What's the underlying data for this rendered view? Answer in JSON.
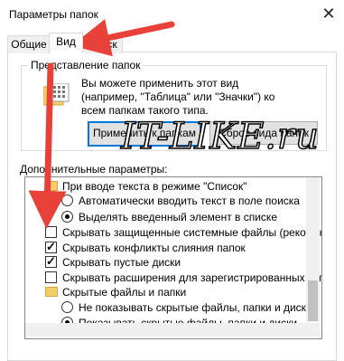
{
  "window": {
    "title": "Параметры папок",
    "close_glyph": "✕"
  },
  "tabs": [
    {
      "label": "Общие",
      "active": false
    },
    {
      "label": "Вид",
      "active": true
    },
    {
      "label": "Поиск",
      "active": false
    }
  ],
  "folder_view": {
    "group_label": "Представление папок",
    "description": "Вы можете применить этот вид (например, \"Таблица\" или \"Значки\") ко всем папкам такого типа.",
    "apply_button": "Применить к папкам",
    "reset_button": "Сброс вида папок"
  },
  "advanced": {
    "label": "Дополнительные параметры:",
    "items": [
      {
        "type": "folder",
        "text": "При вводе текста в режиме \"Список\"",
        "indent": 0
      },
      {
        "type": "radio",
        "text": "Автоматически вводить текст в поле поиска",
        "checked": false,
        "indent": 1
      },
      {
        "type": "radio",
        "text": "Выделять введенный элемент в списке",
        "checked": true,
        "indent": 1
      },
      {
        "type": "checkbox",
        "text": "Скрывать защищенные системные файлы (рекомен...",
        "checked": false,
        "indent": 0
      },
      {
        "type": "checkbox",
        "text": "Скрывать конфликты слияния папок",
        "checked": true,
        "indent": 0
      },
      {
        "type": "checkbox",
        "text": "Скрывать пустые диски",
        "checked": true,
        "indent": 0
      },
      {
        "type": "checkbox",
        "text": "Скрывать расширения для зарегистрированных типо...",
        "checked": false,
        "indent": 0
      },
      {
        "type": "folder",
        "text": "Скрытые файлы и папки",
        "indent": 0
      },
      {
        "type": "radio",
        "text": "Не показывать скрытые файлы, папки и диски",
        "checked": false,
        "indent": 1
      },
      {
        "type": "radio",
        "text": "Показывать скрытые файлы, папки и диски",
        "checked": true,
        "indent": 1
      }
    ]
  },
  "watermark": "IT-LIKE.ru",
  "colors": {
    "arrow": "#e8413a",
    "accent": "#0078d7",
    "folder": "#f3cf6a"
  }
}
